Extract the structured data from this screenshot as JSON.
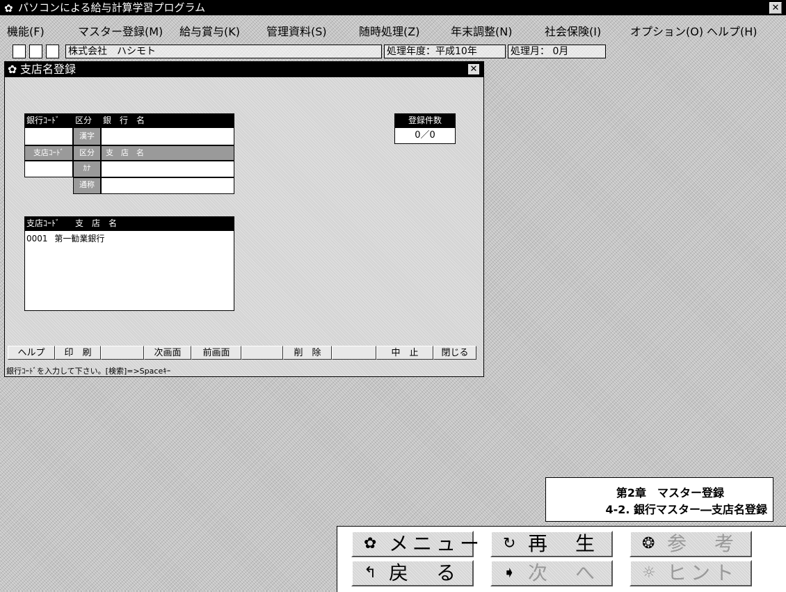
{
  "window": {
    "title": "パソコンによる給与計算学習プログラム",
    "close_label": "✕"
  },
  "menu": [
    "機能(F)",
    "マスター登録(M)",
    "給与賞与(K)",
    "管理資料(S)",
    "随時処理(Z)",
    "年末調整(N)",
    "社会保険(I)",
    "オプション(O)",
    "ヘルプ(H)"
  ],
  "toolbar": {
    "company": "株式会社　ハシモト",
    "year": "処理年度：平成10年",
    "month": "処理月：  0月"
  },
  "subwindow": {
    "title": "支店名登録",
    "close_label": "✕",
    "form": {
      "bank_code_header": "銀行ｺｰﾄﾞ",
      "kubun_header": "区分",
      "bank_name_header": "銀　行　名",
      "kanji_label": "漢字",
      "branch_code_header": "支店ｺｰﾄﾞ",
      "kubun2_label": "区分",
      "branch_name_header": "支　店　名",
      "kana_label": "ｶﾅ",
      "tsusho_label": "通称"
    },
    "count": {
      "header": "登録件数",
      "value": "0／0"
    },
    "list": {
      "code_header": "支店ｺｰﾄﾞ",
      "name_header": "支　店　名",
      "rows": [
        {
          "code": "0001",
          "name": "第一勧業銀行"
        }
      ]
    },
    "fkeys": [
      "ヘルプ",
      "印　刷",
      "",
      "次画面",
      "前画面",
      "",
      "削　除",
      "",
      "中　止",
      "閉じる"
    ],
    "status": "銀行ｺｰﾄﾞを入力して下さい。[検索]=>Spaceｷｰ"
  },
  "caption": {
    "line1": "第2章　マスター登録",
    "line2": "4-2. 銀行マスター―支店名登録"
  },
  "nav": {
    "menu": "メニュー",
    "replay": "再　生",
    "reference": "参　考",
    "back": "戻　る",
    "next": "次　へ",
    "hint": "ヒント"
  }
}
